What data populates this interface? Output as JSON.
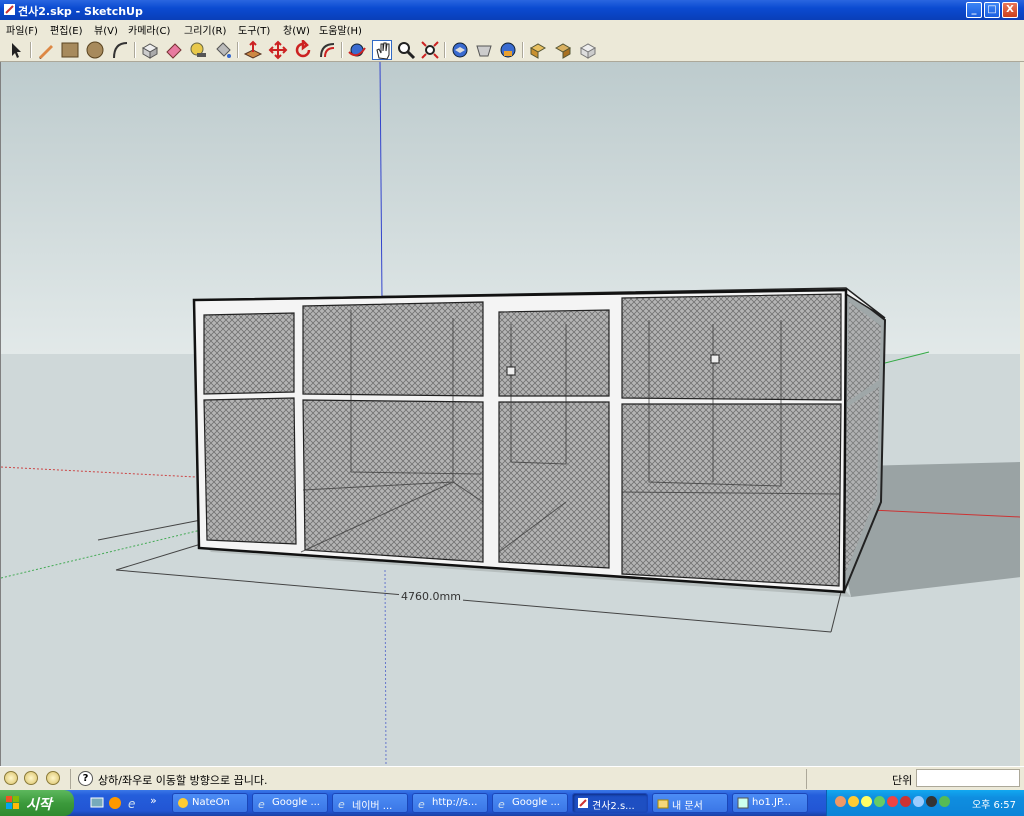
{
  "window": {
    "title": "견사2.skp - SketchUp",
    "buttons": {
      "minimize": "_",
      "maximize": "□",
      "close": "X"
    }
  },
  "menu": [
    "파일(F)",
    "편집(E)",
    "뷰(V)",
    "카메라(C)",
    "그리기(R)",
    "도구(T)",
    "창(W)",
    "도움말(H)"
  ],
  "toolbar": {
    "tools": [
      "select-icon",
      "pencil-icon",
      "rectangle-icon",
      "circle-icon",
      "arc-icon",
      "make-component-icon",
      "eraser-icon",
      "tape-measure-icon",
      "paint-bucket-icon",
      "push-pull-icon",
      "move-icon",
      "rotate-icon",
      "offset-icon",
      "orbit-icon",
      "pan-icon",
      "zoom-icon",
      "zoom-extents-icon",
      "iso-view-icon",
      "top-view-icon",
      "front-view-icon",
      "right-view-icon",
      "back-view-icon",
      "left-view-icon"
    ]
  },
  "viewport": {
    "dimension_label": "4760.0mm",
    "sky_color": "#d4dfe0",
    "ground_color": "#cfd8d9"
  },
  "statusbar": {
    "help_glyph": "?",
    "message": "상하/좌우로 이동할 방향으로 끕니다.",
    "measurement_label": "단위",
    "measurement_value": ""
  },
  "taskbar": {
    "start_label": "시작",
    "chevron": "»",
    "tasks": [
      {
        "label": "NateOn",
        "icon": "nateon-icon"
      },
      {
        "label": "Google ...",
        "icon": "ie-icon"
      },
      {
        "label": "네이버 ...",
        "icon": "ie-icon"
      },
      {
        "label": "http://s...",
        "icon": "ie-icon"
      },
      {
        "label": "Google ...",
        "icon": "ie-icon"
      },
      {
        "label": "견사2.s...",
        "icon": "sketchup-icon"
      },
      {
        "label": "내 문서",
        "icon": "folder-icon"
      },
      {
        "label": "ho1.JP...",
        "icon": "image-icon"
      }
    ],
    "clock": "오후 6:57"
  }
}
